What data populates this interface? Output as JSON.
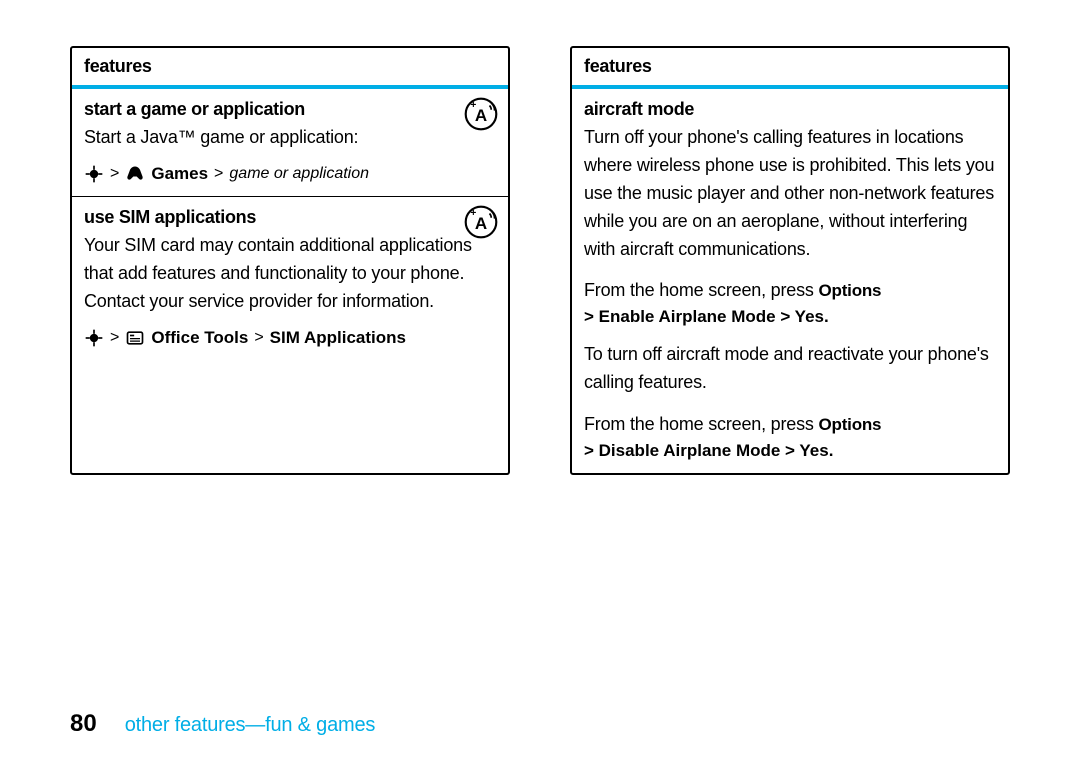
{
  "left": {
    "header": "features",
    "sec1": {
      "title": "start a game or application",
      "body": "Start a Java™ game or application:",
      "nav_games": "Games",
      "nav_game_or_app": "game or application"
    },
    "sec2": {
      "title": "use SIM applications",
      "body": "Your SIM card may contain additional applications that add features and functionality to your phone. Contact your service provider for information.",
      "nav_office": "Office Tools",
      "nav_sim": "SIM Applications"
    }
  },
  "right": {
    "header": "features",
    "sec1": {
      "title": "aircraft mode",
      "p1": "Turn off your phone's calling features in locations where wireless phone use is prohibited. This lets you use the music player and other non-network features while you are on an aeroplane, without interfering with aircraft communications.",
      "p2a": "From the home screen, press ",
      "p2b": "Options",
      "p3": "> Enable Airplane Mode > Yes",
      "p4": "To turn off aircraft mode and reactivate your phone's calling features.",
      "p5a": "From the home screen, press ",
      "p5b": "Options",
      "p6": "> Disable Airplane Mode > Yes"
    }
  },
  "footer": {
    "page": "80",
    "title": "other features—fun & games"
  },
  "glyphs": {
    "sep": ">"
  }
}
